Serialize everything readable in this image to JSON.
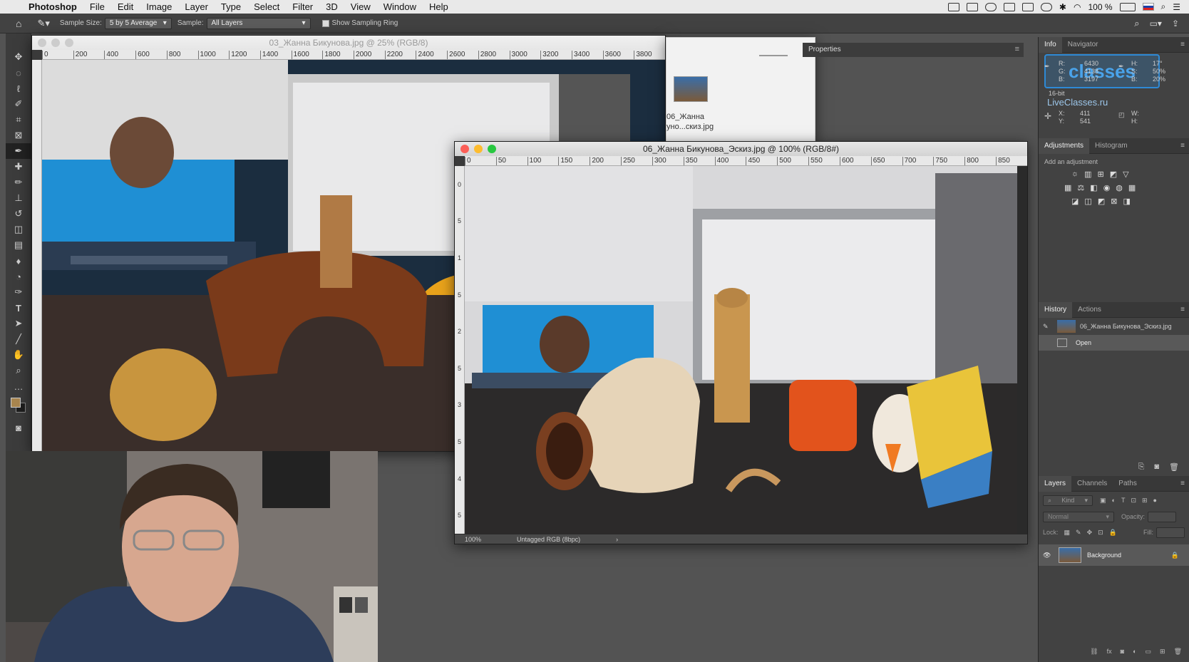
{
  "menubar": {
    "app": "Photoshop",
    "items": [
      "File",
      "Edit",
      "Image",
      "Layer",
      "Type",
      "Select",
      "Filter",
      "3D",
      "View",
      "Window",
      "Help"
    ],
    "battery": "100 %"
  },
  "options": {
    "sample_size_label": "Sample Size:",
    "sample_size_value": "5 by 5 Average",
    "sample_label": "Sample:",
    "sample_value": "All Layers",
    "show_ring_label": "Show Sampling Ring"
  },
  "doc_back": {
    "title": "03_Жанна Бикунова.jpg @ 25% (RGB/8)",
    "ruler": [
      "0",
      "200",
      "400",
      "600",
      "800",
      "1000",
      "1200",
      "1400",
      "1600",
      "1800",
      "2000",
      "2200",
      "2400",
      "2600",
      "2800",
      "3000",
      "3200",
      "3400",
      "3600",
      "3800"
    ]
  },
  "doc_front": {
    "title": "06_Жанна Бикунова_Эскиз.jpg @ 100% (RGB/8#)",
    "ruler": [
      "0",
      "50",
      "100",
      "150",
      "200",
      "250",
      "300",
      "350",
      "400",
      "450",
      "500",
      "550",
      "600",
      "650",
      "700",
      "750",
      "800",
      "850"
    ],
    "vruler": [
      "0",
      "5",
      "1",
      "5",
      "2",
      "5",
      "3",
      "5",
      "4",
      "5"
    ],
    "zoom": "100%",
    "profile": "Untagged RGB (8bpc)"
  },
  "thumbnail": {
    "caption_line1": "06_Жанна",
    "caption_line2": "уно...скиз.jpg"
  },
  "properties": {
    "tab": "Properties"
  },
  "info": {
    "tabs": [
      "Info",
      "Navigator"
    ],
    "r_label": "R:",
    "r_value": "6430",
    "g_label": "G:",
    "g_value": "4138",
    "b_label": "B:",
    "b_value": "3197",
    "h_label": "H:",
    "h_value": "17°",
    "s_label": "S:",
    "s_value": "50%",
    "b2_label": "B:",
    "b2_value": "20%",
    "bits": "16-bit",
    "x_label": "X:",
    "x_value": "411",
    "y_label": "Y:",
    "y_value": "541",
    "w_label": "W:",
    "h2_label": "H:",
    "watermark": "LiveClasses.ru"
  },
  "adjustments": {
    "tabs": [
      "Adjustments",
      "Histogram"
    ],
    "hint": "Add an adjustment"
  },
  "history": {
    "tabs": [
      "History",
      "Actions"
    ],
    "snapshot": "06_Жанна Бикунова_Эскиз.jpg",
    "step": "Open"
  },
  "layers": {
    "tabs": [
      "Layers",
      "Channels",
      "Paths"
    ],
    "kind": "Kind",
    "blend": "Normal",
    "opacity_label": "Opacity:",
    "lock_label": "Lock:",
    "fill_label": "Fill:",
    "layer_name": "Background"
  },
  "colors": {
    "fg": "#a9864f",
    "bg": "#1e1e1e",
    "desk": "#2c2a2a",
    "screen_blue": "#1f8fd4"
  }
}
